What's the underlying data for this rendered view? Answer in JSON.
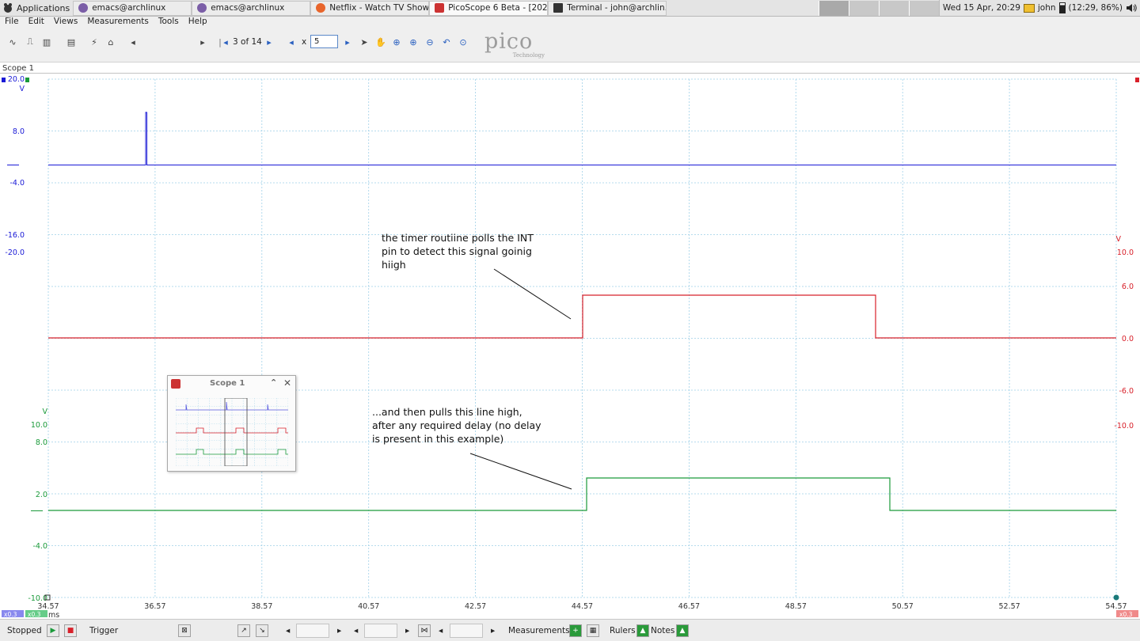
{
  "taskbar": {
    "apps_label": "Applications",
    "tasks": [
      {
        "label": "emacs@archlinux",
        "icon": "emacs-icon"
      },
      {
        "label": "emacs@archlinux",
        "icon": "emacs-icon"
      },
      {
        "label": "Netflix - Watch TV Show...",
        "icon": "firefox-icon"
      },
      {
        "label": "PicoScope 6 Beta - [202...",
        "icon": "picoscope-icon"
      },
      {
        "label": "Terminal - john@archlin...",
        "icon": "terminal-icon"
      }
    ],
    "datetime": "Wed 15 Apr, 20:29",
    "user": "john",
    "battery": "(12:29, 86%)"
  },
  "menu": [
    "File",
    "Edit",
    "Views",
    "Measurements",
    "Tools",
    "Help"
  ],
  "toolbar": {
    "page_indicator": "3 of 14",
    "zoom_prefix": "x",
    "zoom_value": "5"
  },
  "logo": {
    "name": "pico",
    "sub": "Technology"
  },
  "scope_tab": "Scope 1",
  "axes": {
    "blue": {
      "unit": "V",
      "ticks": [
        "20.0",
        "8.0",
        "-4.0",
        "-16.0"
      ],
      "color": "#1a1ad6"
    },
    "blue_extra": "-20.0",
    "red": {
      "unit": "V",
      "ticks": [
        "10.0",
        "6.0",
        "0.0",
        "-6.0",
        "-10.0"
      ],
      "color": "#d8202a"
    },
    "green": {
      "unit": "V",
      "ticks": [
        "10.0",
        "8.0",
        "2.0",
        "-4.0",
        "-10.0"
      ],
      "color": "#1a9a3a"
    },
    "x": {
      "ticks": [
        "34.57",
        "36.57",
        "38.57",
        "40.57",
        "42.57",
        "44.57",
        "46.57",
        "48.57",
        "50.57",
        "52.57",
        "54.57"
      ],
      "unit": "ms"
    },
    "x_badges": {
      "left1": "x0.3",
      "left2": "x0.3",
      "right": "x0.3"
    }
  },
  "annotations": {
    "top": [
      "the timer routiine polls the INT",
      "pin to detect this signal goinig",
      "hiigh"
    ],
    "bottom": [
      "...and then pulls this line high,",
      "after any required delay (no delay",
      "is present in this example)"
    ]
  },
  "mini_window": {
    "title": "Scope 1"
  },
  "statusbar": {
    "state": "Stopped",
    "trigger": "Trigger",
    "measurements": "Measurements",
    "rulers": "Rulers",
    "notes": "Notes"
  }
}
